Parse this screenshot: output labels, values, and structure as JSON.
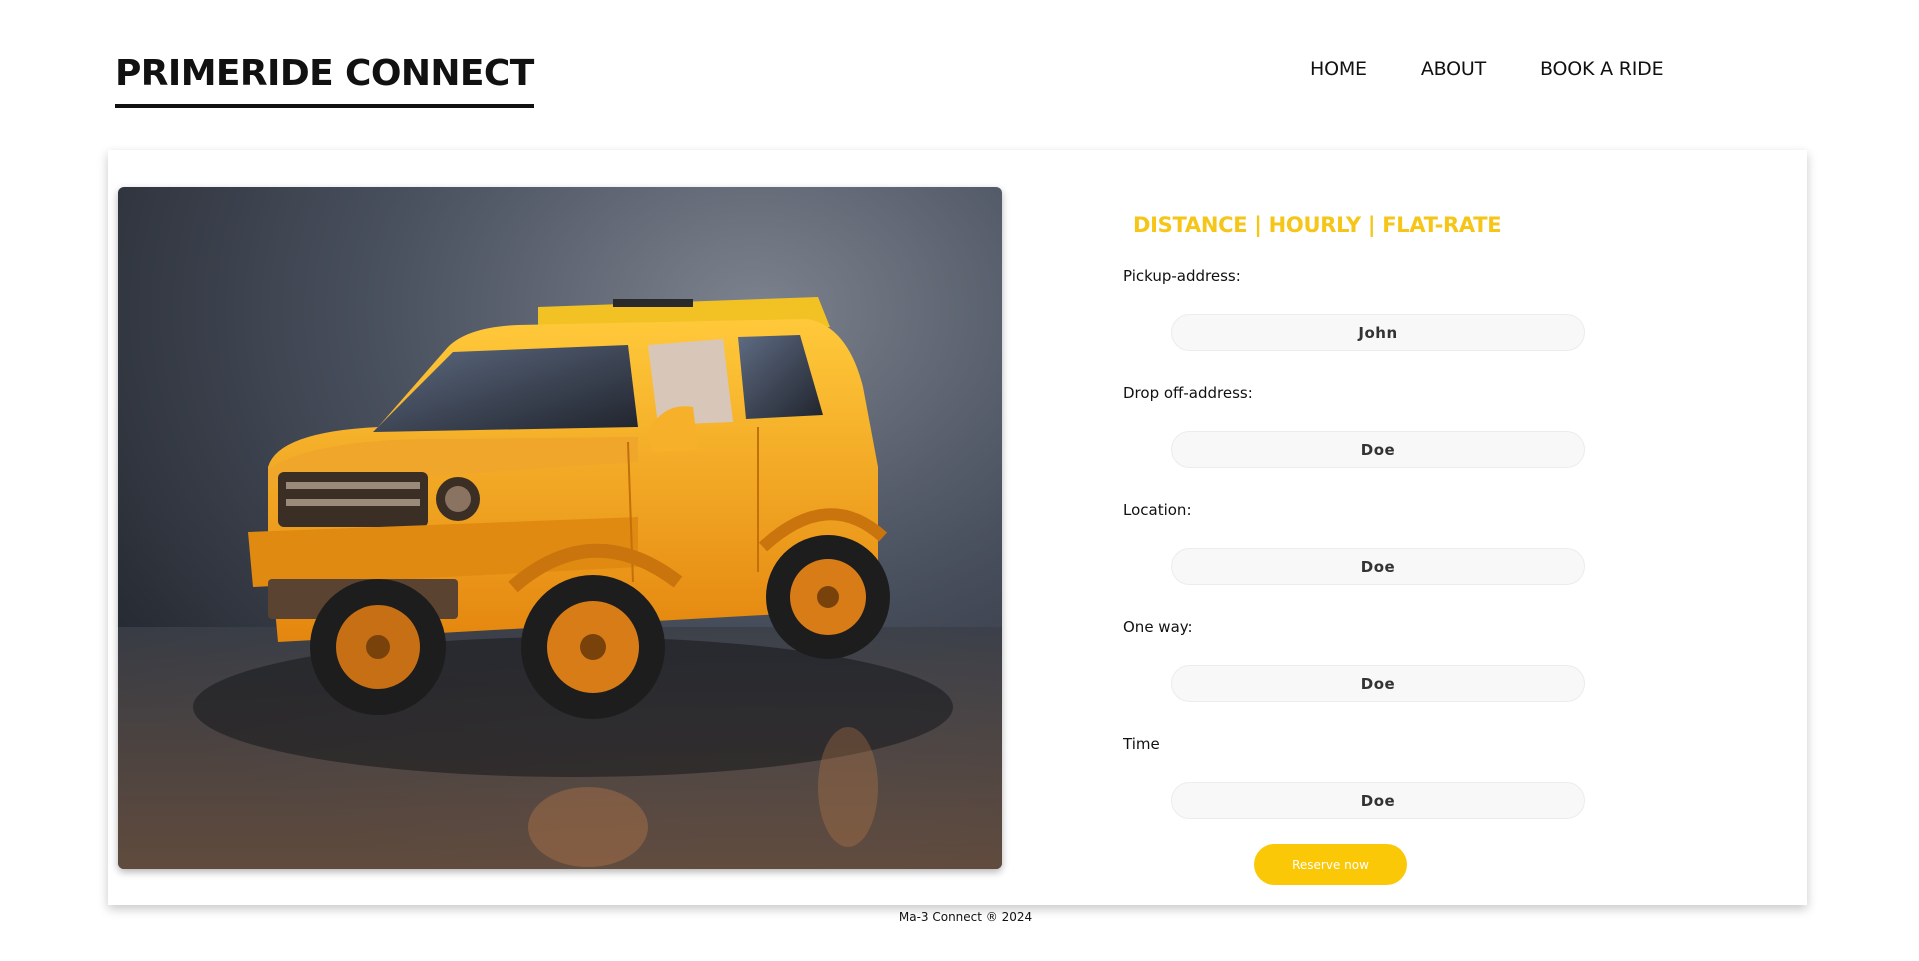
{
  "header": {
    "brand": "PRIMERIDE CONNECT",
    "nav": [
      "HOME",
      "ABOUT",
      "BOOK A RIDE"
    ]
  },
  "hero_image": {
    "subject": "orange SUV"
  },
  "form": {
    "title": "DISTANCE | HOURLY | FLAT-RATE",
    "fields": [
      {
        "label": "Pickup-address:",
        "value": "John"
      },
      {
        "label": "Drop off-address:",
        "value": "Doe"
      },
      {
        "label": "Location:",
        "value": "Doe"
      },
      {
        "label": "One way:",
        "value": "Doe"
      },
      {
        "label": "Time",
        "value": "Doe"
      }
    ],
    "submit_label": "Reserve now"
  },
  "footer": {
    "text": "Ma-3 Connect ® 2024"
  },
  "colors": {
    "accent": "#f5c518",
    "button": "#fbc808"
  }
}
